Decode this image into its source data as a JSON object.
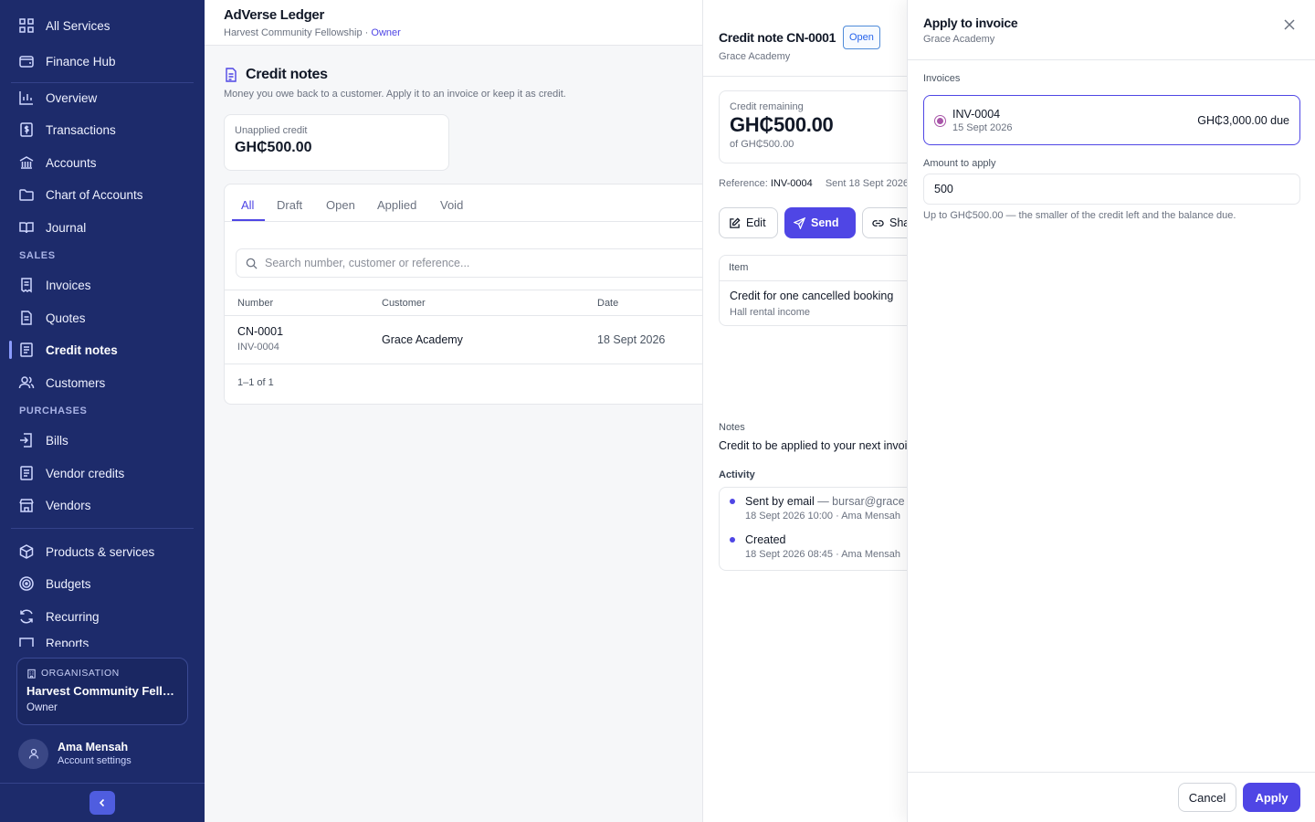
{
  "sidebar": {
    "items": [
      {
        "label": "All Services",
        "icon": "grid-icon"
      },
      {
        "label": "Finance Hub",
        "icon": "wallet-icon"
      },
      {
        "label": "Overview",
        "icon": "chart-icon"
      },
      {
        "label": "Transactions",
        "icon": "dollar-doc-icon"
      },
      {
        "label": "Accounts",
        "icon": "bank-icon"
      },
      {
        "label": "Chart of Accounts",
        "icon": "folder-icon"
      },
      {
        "label": "Journal",
        "icon": "book-icon"
      },
      {
        "label": "Invoices",
        "icon": "receipt-icon"
      },
      {
        "label": "Quotes",
        "icon": "document-icon"
      },
      {
        "label": "Credit notes",
        "icon": "list-doc-icon"
      },
      {
        "label": "Customers",
        "icon": "users-icon"
      },
      {
        "label": "Bills",
        "icon": "bill-icon"
      },
      {
        "label": "Vendor credits",
        "icon": "list-doc-icon"
      },
      {
        "label": "Vendors",
        "icon": "store-icon"
      },
      {
        "label": "Products & services",
        "icon": "box-icon"
      },
      {
        "label": "Budgets",
        "icon": "target-icon"
      },
      {
        "label": "Recurring",
        "icon": "refresh-icon"
      },
      {
        "label": "Reports",
        "icon": "report-icon"
      }
    ],
    "sections": {
      "sales": "SALES",
      "purchases": "PURCHASES"
    },
    "org": {
      "eyebrow": "ORGANISATION",
      "name": "Harvest Community Fello...",
      "role": "Owner"
    },
    "user": {
      "name": "Ama Mensah",
      "sub": "Account settings"
    }
  },
  "header": {
    "app_title": "AdVerse Ledger",
    "org": "Harvest Community Fellowship",
    "separator": " · ",
    "role": "Owner"
  },
  "page": {
    "title": "Credit notes",
    "description": "Money you owe back to a customer. Apply it to an invoice or keep it as credit.",
    "stat": {
      "label": "Unapplied credit",
      "value": "GH₵500.00"
    },
    "tabs": [
      "All",
      "Draft",
      "Open",
      "Applied",
      "Void"
    ],
    "search_placeholder": "Search number, customer or reference...",
    "columns": [
      "Number",
      "Customer",
      "Date"
    ],
    "rows": [
      {
        "number": "CN-0001",
        "ref": "INV-0004",
        "customer": "Grace Academy",
        "date": "18 Sept 2026"
      }
    ],
    "pager": "1–1 of 1"
  },
  "drawer": {
    "title": "Credit note CN-0001",
    "status": "Open",
    "customer": "Grace Academy",
    "credit_label": "Credit remaining",
    "credit_value": "GH₵500.00",
    "credit_of": "of GH₵500.00",
    "reference_label": "Reference: ",
    "reference_value": "INV-0004",
    "sent": "Sent 18 Sept 2026",
    "buttons": {
      "edit": "Edit",
      "send": "Send",
      "share": "Share"
    },
    "item_header": "Item",
    "item_desc": "Credit for one cancelled booking",
    "item_sub": "Hall rental income",
    "notes_label": "Notes",
    "notes_text": "Credit to be applied to your next invoice",
    "activity_label": "Activity",
    "activity": [
      {
        "title": "Sent by email",
        "detail": " — bursar@grace",
        "meta": "18 Sept 2026 10:00 · Ama Mensah"
      },
      {
        "title": "Created",
        "detail": "",
        "meta": "18 Sept 2026 08:45 · Ama Mensah"
      }
    ]
  },
  "panel": {
    "title": "Apply to invoice",
    "subtitle": "Grace Academy",
    "invoices_label": "Invoices",
    "invoice": {
      "number": "INV-0004",
      "date": "15 Sept 2026",
      "due": "GH₵3,000.00 due"
    },
    "amount_label": "Amount to apply",
    "amount_value": "500",
    "hint": "Up to GH₵500.00 — the smaller of the credit left and the balance due.",
    "cancel": "Cancel",
    "apply": "Apply"
  },
  "colors": {
    "sidebar": "#1d2b6b",
    "accent": "#4f46e5",
    "radio": "#a855a8"
  }
}
